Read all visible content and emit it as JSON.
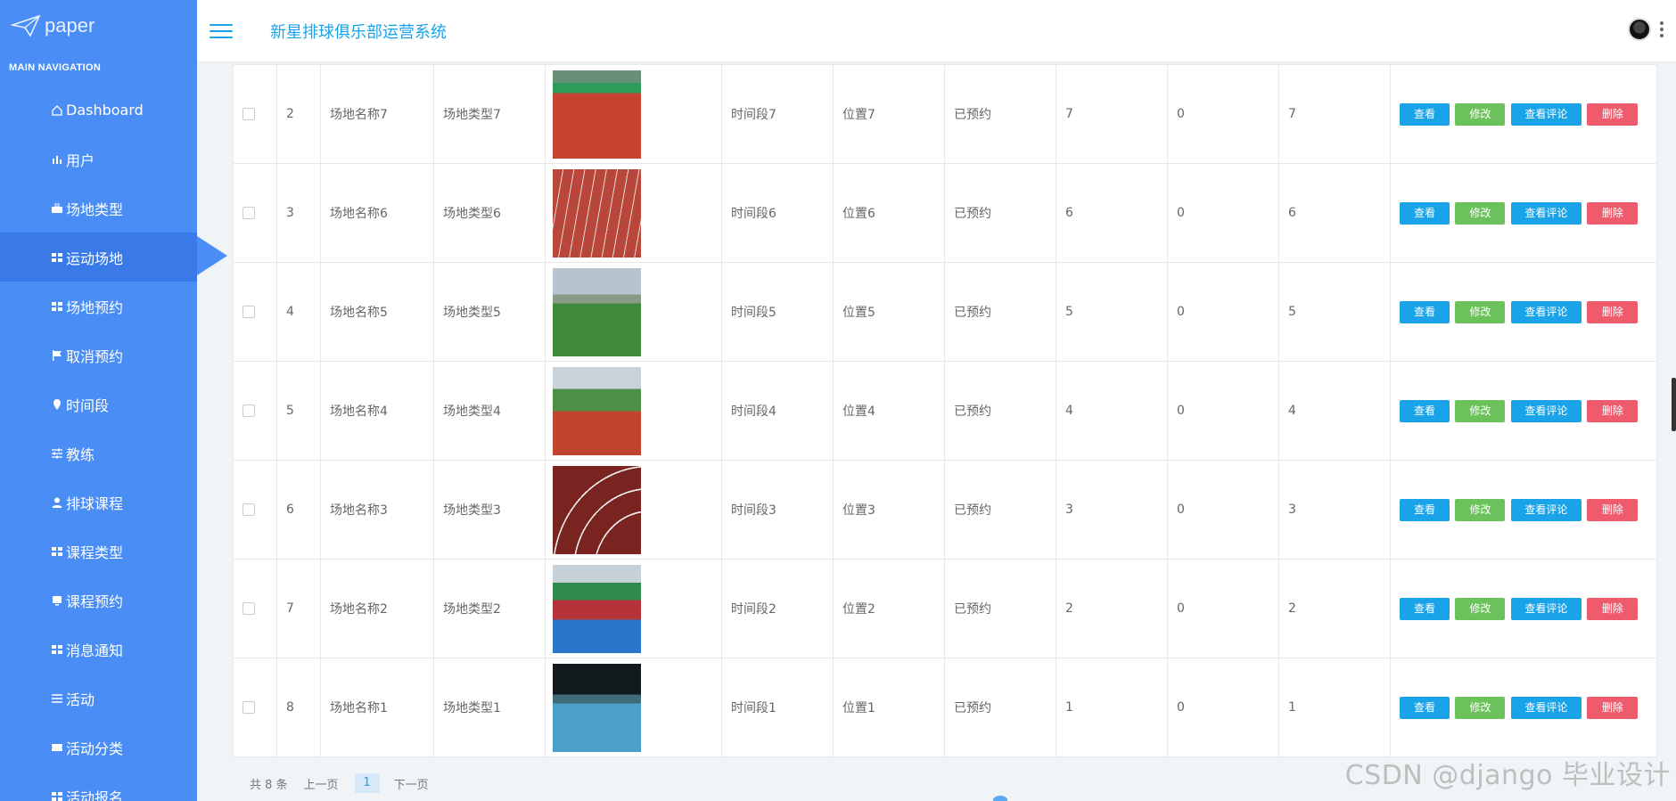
{
  "app": {
    "logo_text": "paper",
    "system_title": "新星排球俱乐部运营系统",
    "nav_header": "MAIN NAVIGATION"
  },
  "sidebar": {
    "items": [
      {
        "label": "Dashboard",
        "icon": "home-icon"
      },
      {
        "label": "用户",
        "icon": "bar-chart-icon"
      },
      {
        "label": "场地类型",
        "icon": "briefcase-icon"
      },
      {
        "label": "运动场地",
        "icon": "grid-icon"
      },
      {
        "label": "场地预约",
        "icon": "grid-icon"
      },
      {
        "label": "取消预约",
        "icon": "flag-icon"
      },
      {
        "label": "时间段",
        "icon": "pin-icon"
      },
      {
        "label": "教练",
        "icon": "sliders-icon"
      },
      {
        "label": "排球课程",
        "icon": "user-icon"
      },
      {
        "label": "课程类型",
        "icon": "grid-icon"
      },
      {
        "label": "课程预约",
        "icon": "chat-icon"
      },
      {
        "label": "消息通知",
        "icon": "grid-icon"
      },
      {
        "label": "活动",
        "icon": "list-icon"
      },
      {
        "label": "活动分类",
        "icon": "ticket-icon"
      },
      {
        "label": "活动报名",
        "icon": "grid-icon"
      }
    ]
  },
  "table": {
    "rows": [
      {
        "idx": "2",
        "name": "场地名称7",
        "type": "场地类型7",
        "period": "时间段7",
        "location": "位置7",
        "status": "已预约",
        "n1": "7",
        "n2": "0",
        "n3": "7",
        "img": "track-red-green"
      },
      {
        "idx": "3",
        "name": "场地名称6",
        "type": "场地类型6",
        "period": "时间段6",
        "location": "位置6",
        "status": "已预约",
        "n1": "6",
        "n2": "0",
        "n3": "6",
        "img": "track-lanes"
      },
      {
        "idx": "4",
        "name": "场地名称5",
        "type": "场地类型5",
        "period": "时间段5",
        "location": "位置5",
        "status": "已预约",
        "n1": "5",
        "n2": "0",
        "n3": "5",
        "img": "grass-field"
      },
      {
        "idx": "5",
        "name": "场地名称4",
        "type": "场地类型4",
        "period": "时间段4",
        "location": "位置4",
        "status": "已预约",
        "n1": "4",
        "n2": "0",
        "n3": "4",
        "img": "track-grass"
      },
      {
        "idx": "6",
        "name": "场地名称3",
        "type": "场地类型3",
        "period": "时间段3",
        "location": "位置3",
        "status": "已预约",
        "n1": "3",
        "n2": "0",
        "n3": "3",
        "img": "track-curve"
      },
      {
        "idx": "7",
        "name": "场地名称2",
        "type": "场地类型2",
        "period": "时间段2",
        "location": "位置2",
        "status": "已预约",
        "n1": "2",
        "n2": "0",
        "n3": "2",
        "img": "track-blue"
      },
      {
        "idx": "8",
        "name": "场地名称1",
        "type": "场地类型1",
        "period": "时间段1",
        "location": "位置1",
        "status": "已预约",
        "n1": "1",
        "n2": "0",
        "n3": "1",
        "img": "court-night"
      }
    ],
    "actions": {
      "view": "查看",
      "edit": "修改",
      "review": "查看评论",
      "delete": "删除"
    }
  },
  "pager": {
    "total": "共 8 条",
    "prev": "上一页",
    "current": "1",
    "next": "下一页"
  },
  "watermark": "CSDN @django 毕业设计",
  "colors": {
    "sidebar": "#4a8ef5",
    "accent": "#1aa3e8",
    "edit": "#6cc25a",
    "delete": "#ee5b6d"
  }
}
